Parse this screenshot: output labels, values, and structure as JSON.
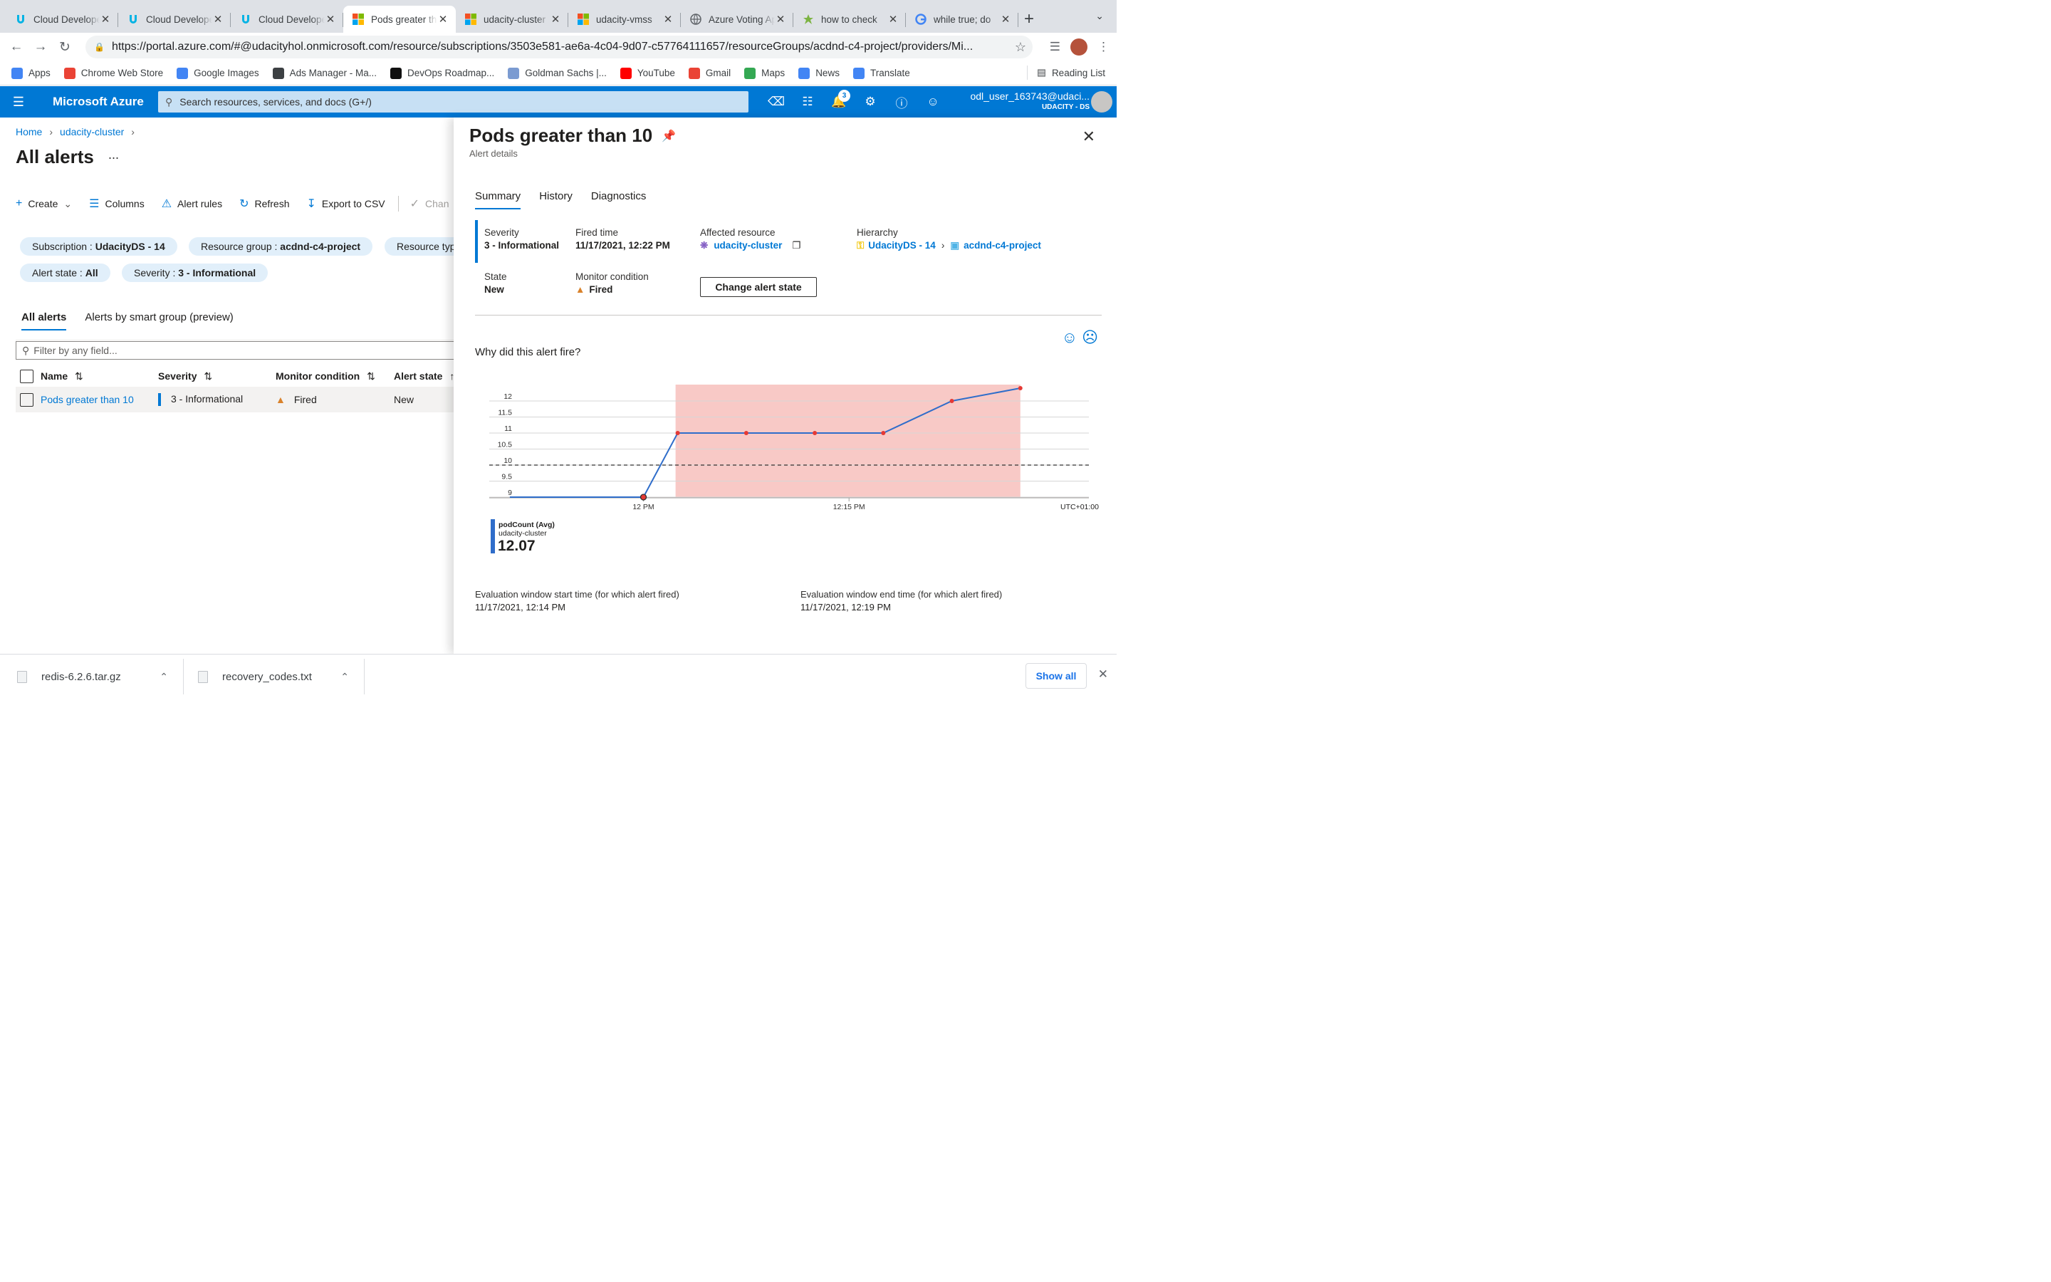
{
  "browser": {
    "tabs": [
      {
        "title": "Cloud Developer",
        "icon": "udacity-icon",
        "active": false
      },
      {
        "title": "Cloud Developer",
        "icon": "udacity-icon",
        "active": false
      },
      {
        "title": "Cloud Developer",
        "icon": "udacity-icon",
        "active": false
      },
      {
        "title": "Pods greater than 10",
        "icon": "microsoft-icon",
        "active": true
      },
      {
        "title": "udacity-cluster",
        "icon": "microsoft-icon",
        "active": false
      },
      {
        "title": "udacity-vmss",
        "icon": "microsoft-icon",
        "active": false
      },
      {
        "title": "Azure Voting App",
        "icon": "globe-icon",
        "active": false
      },
      {
        "title": "how to check",
        "icon": "star-icon",
        "active": false
      },
      {
        "title": "while true; do",
        "icon": "google-icon",
        "active": false
      }
    ],
    "url": "https://portal.azure.com/#@udacityhol.onmicrosoft.com/resource/subscriptions/3503e581-ae6a-4c04-9d07-c57764111657/resourceGroups/acdnd-c4-project/providers/Mi...",
    "bookmarks": [
      "Apps",
      "Chrome Web Store",
      "Google Images",
      "Ads Manager - Ma...",
      "DevOps Roadmap...",
      "Goldman Sachs |...",
      "YouTube",
      "Gmail",
      "Maps",
      "News",
      "Translate"
    ],
    "bookmark_colors": [
      "#4285f4",
      "#ea4335",
      "#4285f4",
      "#3c4043",
      "#111111",
      "#7b9bd1",
      "#ff0000",
      "#ea4335",
      "#34a853",
      "#4285f4",
      "#4285f4"
    ],
    "reading_list": "Reading List"
  },
  "azure": {
    "brand": "Microsoft Azure",
    "search_placeholder": "Search resources, services, and docs (G+/)",
    "notification_count": "3",
    "user_name": "odl_user_163743@udaci...",
    "user_tenant": "UDACITY - DS",
    "accent": "#0078d4"
  },
  "left": {
    "breadcrumb": [
      "Home",
      "udacity-cluster"
    ],
    "title": "All alerts",
    "more": "...",
    "toolbar": {
      "create": "Create",
      "columns": "Columns",
      "alert_rules": "Alert rules",
      "refresh": "Refresh",
      "export": "Export to CSV",
      "change": "Chan"
    },
    "pills": {
      "subscription_k": "Subscription : ",
      "subscription_v": "UdacityDS - 14",
      "rg_k": "Resource group : ",
      "rg_v": "acdnd-c4-project",
      "rtype_k": "Resource typ",
      "state_k": "Alert state : ",
      "state_v": "All",
      "sev_k": "Severity : ",
      "sev_v": "3 - Informational"
    },
    "tabs": [
      "All alerts",
      "Alerts by smart group (preview)"
    ],
    "filter_placeholder": "Filter by any field...",
    "columns": [
      "Name",
      "Severity",
      "Monitor condition",
      "Alert state"
    ],
    "row": {
      "name": "Pods greater than 10",
      "severity": "3 - Informational",
      "condition": "Fired",
      "state": "New"
    }
  },
  "panel": {
    "title": "Pods greater than 10",
    "subtitle": "Alert details",
    "tabs": [
      "Summary",
      "History",
      "Diagnostics"
    ],
    "severity_label": "Severity",
    "severity_value": "3 - Informational",
    "fired_label": "Fired time",
    "fired_value": "11/17/2021, 12:22 PM",
    "affected_label": "Affected resource",
    "affected_value": "udacity-cluster",
    "hierarchy_label": "Hierarchy",
    "hierarchy_sub": "UdacityDS - 14",
    "hierarchy_rg": "acdnd-c4-project",
    "state_label": "State",
    "state_value": "New",
    "monitor_label": "Monitor condition",
    "monitor_value": "Fired",
    "change_button": "Change alert state",
    "why": "Why did this alert fire?",
    "legend_metric": "podCount (Avg)",
    "legend_resource": "udacity-cluster",
    "legend_value": "12.07",
    "eval_start_label": "Evaluation window start time (for which alert fired)",
    "eval_start_value": "11/17/2021, 12:14 PM",
    "eval_end_label": "Evaluation window end time (for which alert fired)",
    "eval_end_value": "11/17/2021, 12:19 PM"
  },
  "chart_data": {
    "type": "line",
    "x": [
      "11:57",
      "12:00",
      "12:02",
      "12:04",
      "12:06",
      "12:08",
      "12:10",
      "12:12"
    ],
    "series": [
      {
        "name": "podCount (Avg)",
        "values": [
          9,
          9,
          9,
          11,
          11,
          11,
          11,
          12
        ]
      }
    ],
    "marked_points": [
      {
        "x": "12:02",
        "y": 11
      },
      {
        "x": "12:04",
        "y": 11
      },
      {
        "x": "12:06",
        "y": 11
      },
      {
        "x": "12:08",
        "y": 11
      },
      {
        "x": "12:10",
        "y": 12
      },
      {
        "x": "12:12",
        "y": 12.4
      }
    ],
    "line_points": [
      [
        -3.9,
        9
      ],
      [
        0,
        9
      ],
      [
        1,
        11
      ],
      [
        3,
        11
      ],
      [
        5,
        11
      ],
      [
        7,
        11
      ],
      [
        9,
        12
      ],
      [
        11,
        12.4
      ]
    ],
    "threshold": 10,
    "highlight_window": [
      1,
      11
    ],
    "yticks": [
      "12",
      "11.5",
      "11",
      "10.5",
      "10",
      "9.5",
      "9"
    ],
    "ylim": [
      9,
      12.4
    ],
    "xtick_labels": [
      "12 PM",
      "12:15 PM"
    ],
    "timezone": "UTC+01:00",
    "grid": true,
    "line_color": "#2f6dca",
    "point_color": "#e53935",
    "highlight_color": "#f8c9c6"
  },
  "downloads": [
    {
      "name": "redis-6.2.6.tar.gz"
    },
    {
      "name": "recovery_codes.txt"
    }
  ],
  "downloads_show_all": "Show all"
}
